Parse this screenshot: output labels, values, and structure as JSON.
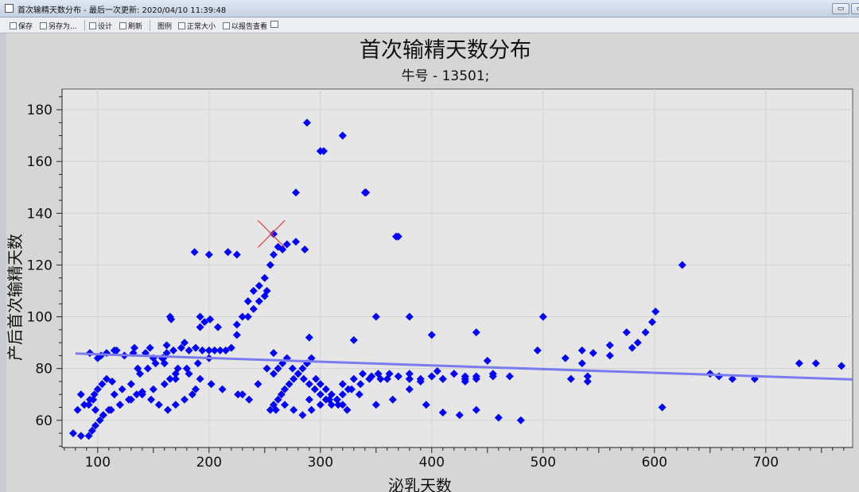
{
  "window": {
    "title": "首次输精天数分布 - 最后一次更新: 2020/04/10 11:39:48",
    "minimize_glyph": "▭",
    "restore_glyph": "▭"
  },
  "toolbar": {
    "save_label": "保存",
    "save_as_label": "另存为...",
    "design_label": "设计",
    "refresh_label": "刷新",
    "legend_label": "图例",
    "normal_size_label": "正常大小",
    "report_view_label": "以报告查看",
    "help_label": "?"
  },
  "chart_data": {
    "type": "scatter",
    "title": "首次输精天数分布",
    "subtitle": "牛号 - 13501;",
    "xlabel": "泌乳天数",
    "ylabel": "产后首次输精天数",
    "xlim": [
      68,
      778
    ],
    "ylim": [
      49.5,
      188
    ],
    "xticks": [
      100,
      200,
      300,
      400,
      500,
      600,
      700
    ],
    "yticks": [
      60,
      80,
      100,
      120,
      140,
      160,
      180
    ],
    "grid": true,
    "marker_color": "#0000ff",
    "trend_color": "#7b7bf0",
    "highlight_color": "#e04040",
    "trend_line": [
      [
        80,
        85.8
      ],
      [
        778,
        75.8
      ]
    ],
    "highlight_point": [
      256,
      132
    ],
    "x": [
      78,
      85,
      92,
      95,
      98,
      102,
      105,
      110,
      120,
      128,
      135,
      140,
      150,
      160,
      165,
      170,
      180,
      190,
      200,
      205,
      210,
      215,
      220,
      225,
      230,
      235,
      240,
      245,
      250,
      255,
      258,
      262,
      266,
      270,
      82,
      88,
      93,
      97,
      100,
      104,
      108,
      115,
      122,
      130,
      138,
      145,
      152,
      158,
      162,
      168,
      175,
      182,
      188,
      194,
      200,
      100,
      108,
      115,
      124,
      133,
      143,
      150,
      160,
      172,
      182,
      192,
      212,
      226,
      236,
      244,
      252,
      258,
      85,
      92,
      98,
      105,
      112,
      120,
      130,
      140,
      148,
      155,
      163,
      170,
      178,
      185,
      255,
      258,
      262,
      265,
      268,
      272,
      276,
      280,
      284,
      288,
      292,
      296,
      300,
      305,
      310,
      315,
      320,
      325,
      330,
      338,
      346,
      354,
      362,
      370,
      380,
      390,
      400,
      410,
      420,
      430,
      440,
      258,
      262,
      266,
      270,
      275,
      280,
      285,
      290,
      295,
      300,
      305,
      310,
      315,
      320,
      328,
      336,
      344,
      352,
      360,
      370,
      380,
      390,
      400,
      410,
      420,
      430,
      440,
      455,
      470,
      260,
      268,
      276,
      284,
      292,
      300,
      308,
      316,
      324,
      335,
      350,
      365,
      380,
      395,
      410,
      425,
      440,
      460,
      480,
      165,
      166,
      192,
      196,
      201,
      290,
      330,
      350,
      380,
      400,
      440,
      450,
      500,
      525,
      535,
      540,
      540,
      560,
      575,
      580,
      585,
      598,
      601,
      93,
      103,
      117,
      132,
      147,
      162,
      178,
      192,
      208,
      225,
      235,
      240,
      245,
      250,
      252,
      96,
      113,
      136,
      159,
      170,
      188,
      202,
      230,
      290,
      320,
      278,
      286,
      303,
      320,
      341,
      368,
      187,
      217,
      225,
      380,
      405,
      430,
      455,
      495,
      520,
      535,
      545,
      560,
      592,
      607,
      625,
      650,
      658,
      670,
      690,
      730,
      745,
      768
    ],
    "y": [
      55,
      54,
      54,
      56,
      58,
      60,
      62,
      64,
      66,
      68,
      70,
      71,
      72,
      74,
      76,
      78,
      80,
      82,
      84,
      87,
      87,
      87,
      88,
      93,
      100,
      106,
      110,
      112,
      115,
      120,
      124,
      127,
      126,
      128,
      64,
      66,
      68,
      70,
      72,
      74,
      76,
      70,
      72,
      74,
      78,
      80,
      82,
      84,
      86,
      87,
      88,
      87,
      88,
      87,
      87,
      84,
      86,
      87,
      85,
      88,
      86,
      84,
      82,
      80,
      78,
      76,
      72,
      70,
      68,
      74,
      80,
      86,
      70,
      66,
      64,
      62,
      64,
      66,
      68,
      70,
      68,
      66,
      64,
      66,
      68,
      70,
      64,
      66,
      68,
      70,
      72,
      74,
      76,
      78,
      80,
      82,
      84,
      76,
      74,
      72,
      70,
      68,
      66,
      72,
      76,
      78,
      77,
      76,
      78,
      77,
      78,
      76,
      77,
      76,
      78,
      77,
      76,
      78,
      80,
      82,
      84,
      80,
      78,
      76,
      74,
      72,
      70,
      68,
      66,
      68,
      70,
      72,
      74,
      76,
      78,
      76,
      77,
      76,
      75,
      77,
      76,
      78,
      76,
      77,
      78,
      77,
      64,
      66,
      64,
      62,
      64,
      66,
      68,
      66,
      64,
      70,
      66,
      68,
      72,
      66,
      63,
      62,
      64,
      61,
      60,
      100,
      99,
      100,
      98,
      99,
      92,
      91,
      100,
      100,
      93,
      94,
      83,
      100,
      76,
      87,
      77,
      75,
      89,
      94,
      88,
      90,
      98,
      102,
      86,
      85,
      87,
      86,
      88,
      89,
      90,
      96,
      96,
      97,
      100,
      103,
      106,
      108,
      110,
      68,
      75,
      80,
      84,
      76,
      72,
      74,
      70,
      68,
      74,
      148,
      126,
      164,
      170,
      148,
      131,
      125,
      125,
      124,
      76,
      79,
      75,
      77,
      87,
      84,
      82,
      86,
      85,
      94,
      65,
      120,
      78,
      77,
      76,
      76,
      82,
      82,
      81
    ],
    "extra_points": [
      [
        288,
        175
      ],
      [
        278,
        129
      ],
      [
        258,
        132
      ],
      [
        300,
        164
      ],
      [
        320,
        170
      ],
      [
        340,
        148
      ],
      [
        370,
        131
      ],
      [
        200,
        124
      ]
    ]
  }
}
